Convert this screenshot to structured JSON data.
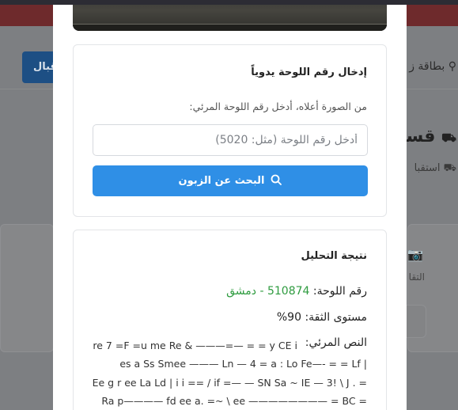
{
  "background": {
    "button_label": "قبال",
    "header_items": [
      "بطاقة ز"
    ],
    "section_title": "قسم",
    "section_subtitle": "استقبا",
    "side_label": "التقا"
  },
  "modal": {
    "manual_entry": {
      "title": "إدخال رقم اللوحة يدوياً",
      "hint": "من الصورة أعلاه، أدخل رقم اللوحة المرئي:",
      "input_value": "",
      "input_placeholder": "أدخل رقم اللوحة (مثل: 5020)",
      "search_button_label": "البحث عن الزبون"
    },
    "analysis": {
      "title": "نتيجة التحليل",
      "plate_label": "رقم اللوحة:",
      "plate_value": "510874 - دمشق",
      "confidence_label": "مستوى الثقة:",
      "confidence_value": "90%",
      "ocr_label": "النص المرئي:",
      "ocr_lines": [
        "re 7 =F =u me Re & ———=— = = y CE i",
        "es a Ss Smee ——— Ln — 4 = a : Lo Fe—- = = Lf |",
        "Ee g r ee La Ld | i i == / if =— — SN Sa ~ IE — 3! \\ J . =",
        "Ra p———— fd ee a. =~ \\ ee ———————— = BC ="
      ]
    }
  },
  "colors": {
    "primary": "#2f8fe6",
    "plate_green": "#2e9b3f",
    "overlay_red": "#6e2a2c"
  }
}
